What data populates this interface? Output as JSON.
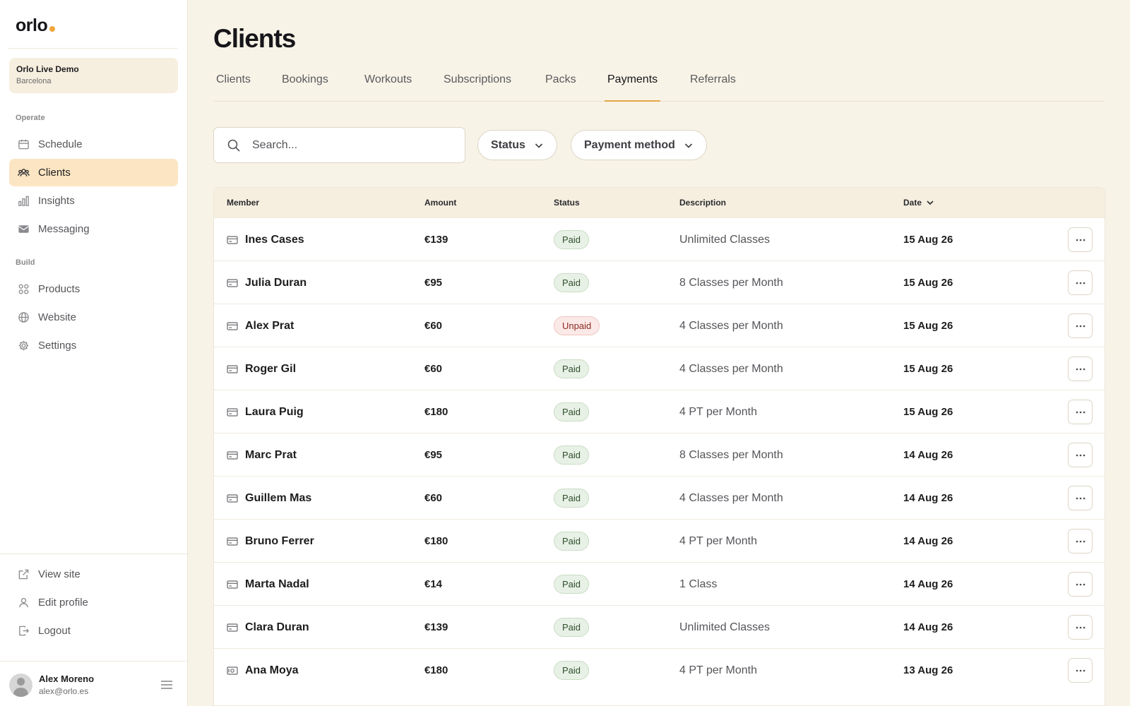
{
  "brand": {
    "name": "orlo",
    "accent": "#f0a63a"
  },
  "org": {
    "name": "Orlo Live Demo",
    "city": "Barcelona"
  },
  "sidebar": {
    "section_operate": "Operate",
    "section_build": "Build",
    "items": [
      {
        "label": "Schedule",
        "icon": "calendar-icon"
      },
      {
        "label": "Clients",
        "icon": "users-icon",
        "active": true
      },
      {
        "label": "Insights",
        "icon": "bar-chart-icon"
      },
      {
        "label": "Messaging",
        "icon": "envelope-icon"
      },
      {
        "label": "Products",
        "icon": "grid-icon"
      },
      {
        "label": "Website",
        "icon": "globe-icon"
      },
      {
        "label": "Settings",
        "icon": "gear-icon"
      }
    ],
    "bottom_items": [
      {
        "label": "View site",
        "icon": "external-link-icon"
      },
      {
        "label": "Edit profile",
        "icon": "user-icon"
      },
      {
        "label": "Logout",
        "icon": "logout-icon"
      }
    ],
    "user": {
      "name": "Alex Moreno",
      "email": "alex@orlo.es"
    }
  },
  "page": {
    "title": "Clients"
  },
  "tabs": [
    {
      "label": "Clients"
    },
    {
      "label": "Bookings"
    },
    {
      "label": "Workouts"
    },
    {
      "label": "Subscriptions"
    },
    {
      "label": "Packs"
    },
    {
      "label": "Payments",
      "active": true
    },
    {
      "label": "Referrals"
    }
  ],
  "search": {
    "placeholder": "Search..."
  },
  "filters": {
    "status": "Status",
    "payment_method": "Payment method"
  },
  "table": {
    "headers": {
      "member": "Member",
      "amount": "Amount",
      "status": "Status",
      "description": "Description",
      "date": "Date"
    },
    "rows": [
      {
        "member": "Ines Cases",
        "amount": "€139",
        "status": "Paid",
        "description": "Unlimited Classes",
        "date": "15 Aug 26",
        "method_icon": "card-icon"
      },
      {
        "member": "Julia Duran",
        "amount": "€95",
        "status": "Paid",
        "description": "8 Classes per Month",
        "date": "15 Aug 26",
        "method_icon": "card-icon"
      },
      {
        "member": "Alex Prat",
        "amount": "€60",
        "status": "Unpaid",
        "description": "4 Classes per Month",
        "date": "15 Aug 26",
        "method_icon": "card-icon"
      },
      {
        "member": "Roger Gil",
        "amount": "€60",
        "status": "Paid",
        "description": "4 Classes per Month",
        "date": "15 Aug 26",
        "method_icon": "card-icon"
      },
      {
        "member": "Laura Puig",
        "amount": "€180",
        "status": "Paid",
        "description": "4 PT per Month",
        "date": "15 Aug 26",
        "method_icon": "card-icon"
      },
      {
        "member": "Marc Prat",
        "amount": "€95",
        "status": "Paid",
        "description": "8 Classes per Month",
        "date": "14 Aug 26",
        "method_icon": "card-icon"
      },
      {
        "member": "Guillem Mas",
        "amount": "€60",
        "status": "Paid",
        "description": "4 Classes per Month",
        "date": "14 Aug 26",
        "method_icon": "card-icon"
      },
      {
        "member": "Bruno Ferrer",
        "amount": "€180",
        "status": "Paid",
        "description": "4 PT per Month",
        "date": "14 Aug 26",
        "method_icon": "card-icon"
      },
      {
        "member": "Marta Nadal",
        "amount": "€14",
        "status": "Paid",
        "description": "1 Class",
        "date": "14 Aug 26",
        "method_icon": "card-icon"
      },
      {
        "member": "Clara Duran",
        "amount": "€139",
        "status": "Paid",
        "description": "Unlimited Classes",
        "date": "14 Aug 26",
        "method_icon": "card-icon"
      },
      {
        "member": "Ana Moya",
        "amount": "€180",
        "status": "Paid",
        "description": "4 PT per Month",
        "date": "13 Aug 26",
        "method_icon": "cash-icon"
      }
    ]
  },
  "colors": {
    "paid": "#e8f1e6",
    "unpaid": "#fbe9e7",
    "tab_underline": "#e6a645",
    "active_nav": "#fbe5c3"
  }
}
